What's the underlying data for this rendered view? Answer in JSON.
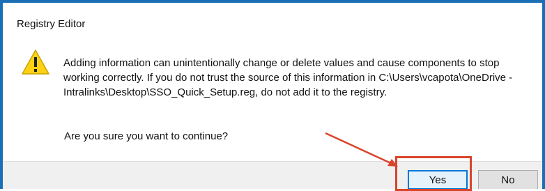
{
  "dialog": {
    "title": "Registry Editor",
    "icon": "warning-triangle-icon",
    "message": "Adding information can unintentionally change or delete values and cause components to stop working correctly. If you do not trust the source of this information in C:\\Users\\vcapota\\OneDrive - Intralinks\\Desktop\\SSO_Quick_Setup.reg, do not add it to the registry.",
    "question": "Are you sure you want to continue?",
    "buttons": {
      "yes": "Yes",
      "no": "No"
    }
  },
  "annotation": {
    "color": "#d9442a",
    "target": "yes-button"
  }
}
